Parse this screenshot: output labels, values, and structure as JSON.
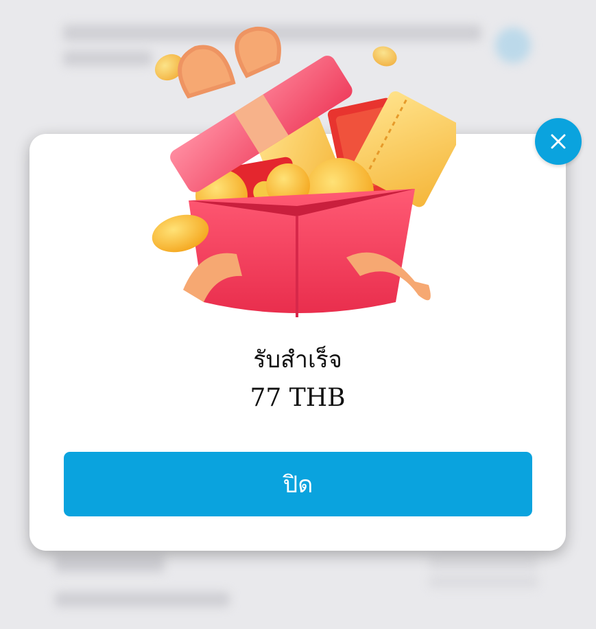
{
  "dialog": {
    "title": "รับสำเร็จ",
    "amount": "77 THB",
    "button_label": "ปิด",
    "close_icon": "close-icon",
    "illustration": "gift-box-icon"
  },
  "colors": {
    "accent": "#0aa3de",
    "dialog_bg": "#ffffff",
    "backdrop": "#e9e9ec",
    "gift_red": "#f0435f",
    "gift_gold": "#f7b52a",
    "ribbon": "#f6a872"
  }
}
